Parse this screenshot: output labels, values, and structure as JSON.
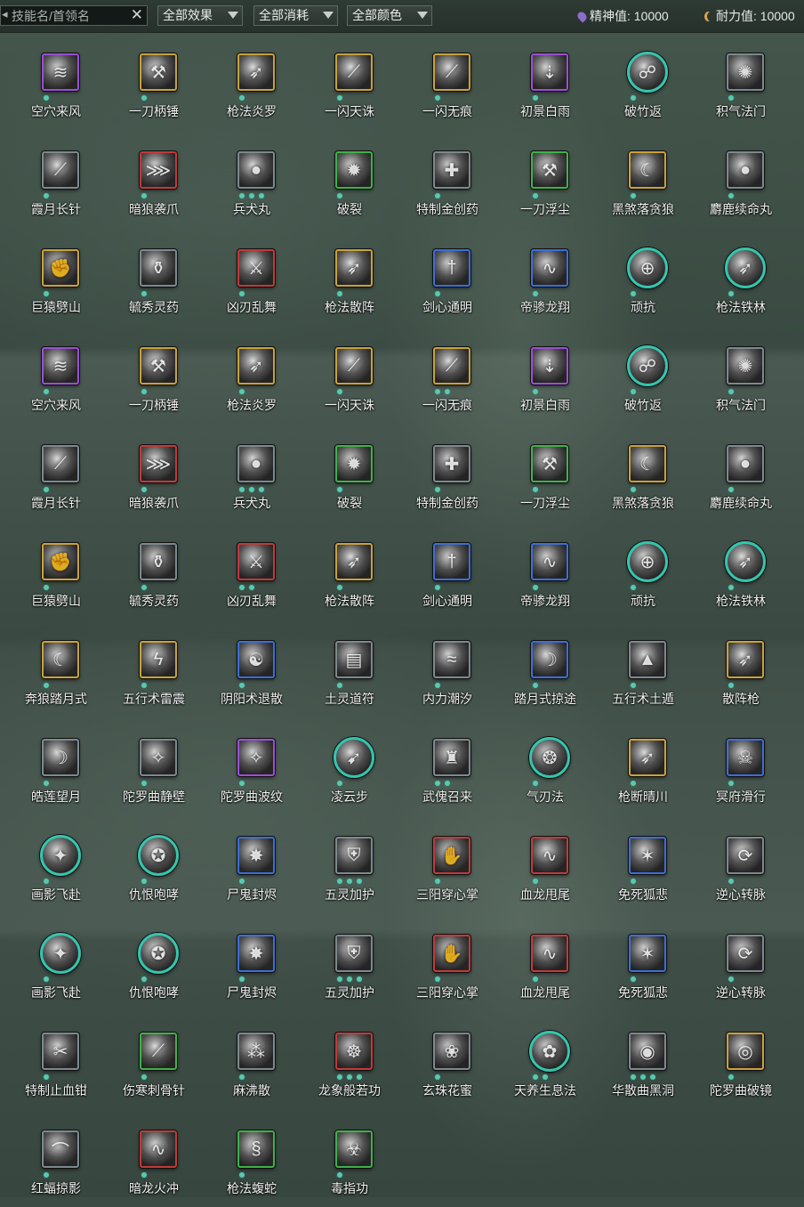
{
  "filters": {
    "search_placeholder": "技能名/首领名",
    "clear_symbol": "✕",
    "effect_label": "全部效果",
    "cost_label": "全部消耗",
    "color_label": "全部颜色"
  },
  "resources": {
    "spirit": "精神值: 10000",
    "stamina": "耐力值: 10000"
  },
  "colors": {
    "purple": "#9b4fd6",
    "gold": "#c9a23c",
    "red": "#c23a3a",
    "green": "#3fb24a",
    "blue": "#3b6fd6",
    "teal": "#34c6ad",
    "gray": "#7c8a8f",
    "dot": "#58c9b0"
  },
  "rows": [
    [
      {
        "name": "空穴来风",
        "frame": "purple",
        "dots": 1,
        "icon": "wind-icon"
      },
      {
        "name": "一刀柄锤",
        "frame": "gold",
        "dots": 1,
        "icon": "strike-icon"
      },
      {
        "name": "枪法炎罗",
        "frame": "gold",
        "dots": 1,
        "icon": "spear-icon"
      },
      {
        "name": "一闪天诛",
        "frame": "gold",
        "dots": 1,
        "icon": "slash-icon"
      },
      {
        "name": "一闪无痕",
        "frame": "gold",
        "dots": 1,
        "icon": "slash-icon"
      },
      {
        "name": "初景白雨",
        "frame": "purple",
        "dots": 1,
        "icon": "rain-icon"
      },
      {
        "name": "破竹返",
        "frame": "teal",
        "round": true,
        "dots": 1,
        "icon": "bamboo-icon"
      },
      {
        "name": "积气法门",
        "frame": "gray",
        "dots": 1,
        "icon": "qi-icon"
      }
    ],
    [
      {
        "name": "霞月长针",
        "frame": "gray",
        "dots": 1,
        "icon": "needle-icon"
      },
      {
        "name": "暗狼袭爪",
        "frame": "red",
        "dots": 1,
        "icon": "claw-icon"
      },
      {
        "name": "兵犬丸",
        "frame": "gray",
        "dots": 3,
        "icon": "pill-icon"
      },
      {
        "name": "破裂",
        "frame": "green",
        "dots": 1,
        "icon": "burst-icon"
      },
      {
        "name": "特制金创药",
        "frame": "gray",
        "dots": 1,
        "icon": "medicine-icon"
      },
      {
        "name": "一刀浮尘",
        "frame": "green",
        "dots": 1,
        "icon": "strike-icon"
      },
      {
        "name": "黑煞落贪狼",
        "frame": "gold",
        "dots": 1,
        "icon": "wolf-icon"
      },
      {
        "name": "麝鹿续命丸",
        "frame": "gray",
        "dots": 1,
        "icon": "pill-icon"
      }
    ],
    [
      {
        "name": "巨猿劈山",
        "frame": "gold",
        "dots": 1,
        "icon": "ape-icon"
      },
      {
        "name": "毓秀灵药",
        "frame": "gray",
        "dots": 1,
        "icon": "gourd-icon"
      },
      {
        "name": "凶刃乱舞",
        "frame": "red",
        "dots": 1,
        "icon": "blade-icon"
      },
      {
        "name": "枪法散阵",
        "frame": "gold",
        "dots": 1,
        "icon": "spear-icon"
      },
      {
        "name": "剑心通明",
        "frame": "blue",
        "dots": 1,
        "icon": "sword-icon"
      },
      {
        "name": "帝骖龙翔",
        "frame": "blue",
        "dots": 1,
        "icon": "dragon-icon"
      },
      {
        "name": "顽抗",
        "frame": "teal",
        "round": true,
        "dots": 1,
        "icon": "resist-icon"
      },
      {
        "name": "枪法铁林",
        "frame": "teal",
        "round": true,
        "dots": 1,
        "icon": "spear-icon"
      }
    ],
    [
      {
        "name": "空穴来风",
        "frame": "purple",
        "dots": 1,
        "icon": "wind-icon"
      },
      {
        "name": "一刀柄锤",
        "frame": "gold",
        "dots": 1,
        "icon": "strike-icon"
      },
      {
        "name": "枪法炎罗",
        "frame": "gold",
        "dots": 1,
        "icon": "spear-icon"
      },
      {
        "name": "一闪天诛",
        "frame": "gold",
        "dots": 1,
        "icon": "slash-icon"
      },
      {
        "name": "一闪无痕",
        "frame": "gold",
        "dots": 2,
        "icon": "slash-icon"
      },
      {
        "name": "初景白雨",
        "frame": "purple",
        "dots": 1,
        "icon": "rain-icon"
      },
      {
        "name": "破竹返",
        "frame": "teal",
        "round": true,
        "dots": 1,
        "icon": "bamboo-icon"
      },
      {
        "name": "积气法门",
        "frame": "gray",
        "dots": 1,
        "icon": "qi-icon"
      }
    ],
    [
      {
        "name": "霞月长针",
        "frame": "gray",
        "dots": 1,
        "icon": "needle-icon"
      },
      {
        "name": "暗狼袭爪",
        "frame": "red",
        "dots": 1,
        "icon": "claw-icon"
      },
      {
        "name": "兵犬丸",
        "frame": "gray",
        "dots": 3,
        "icon": "pill-icon"
      },
      {
        "name": "破裂",
        "frame": "green",
        "dots": 1,
        "icon": "burst-icon"
      },
      {
        "name": "特制金创药",
        "frame": "gray",
        "dots": 1,
        "icon": "medicine-icon"
      },
      {
        "name": "一刀浮尘",
        "frame": "green",
        "dots": 1,
        "icon": "strike-icon"
      },
      {
        "name": "黑煞落贪狼",
        "frame": "gold",
        "dots": 1,
        "icon": "wolf-icon"
      },
      {
        "name": "麝鹿续命丸",
        "frame": "gray",
        "dots": 1,
        "icon": "pill-icon"
      }
    ],
    [
      {
        "name": "巨猿劈山",
        "frame": "gold",
        "dots": 1,
        "icon": "ape-icon"
      },
      {
        "name": "毓秀灵药",
        "frame": "gray",
        "dots": 1,
        "icon": "gourd-icon"
      },
      {
        "name": "凶刃乱舞",
        "frame": "red",
        "dots": 2,
        "icon": "blade-icon"
      },
      {
        "name": "枪法散阵",
        "frame": "gold",
        "dots": 1,
        "icon": "spear-icon"
      },
      {
        "name": "剑心通明",
        "frame": "blue",
        "dots": 1,
        "icon": "sword-icon"
      },
      {
        "name": "帝骖龙翔",
        "frame": "blue",
        "dots": 1,
        "icon": "dragon-icon"
      },
      {
        "name": "顽抗",
        "frame": "teal",
        "round": true,
        "dots": 1,
        "icon": "resist-icon"
      },
      {
        "name": "枪法铁林",
        "frame": "teal",
        "round": true,
        "dots": 1,
        "icon": "spear-icon"
      }
    ],
    [
      {
        "name": "奔狼踏月式",
        "frame": "gold",
        "dots": 1,
        "icon": "wolf-icon"
      },
      {
        "name": "五行术雷震",
        "frame": "gold",
        "dots": 1,
        "icon": "thunder-icon"
      },
      {
        "name": "阴阳术退散",
        "frame": "blue",
        "dots": 1,
        "icon": "yinyang-icon"
      },
      {
        "name": "土灵道符",
        "frame": "gray",
        "dots": 1,
        "icon": "talisman-icon"
      },
      {
        "name": "内力潮汐",
        "frame": "gray",
        "dots": 1,
        "icon": "tide-icon"
      },
      {
        "name": "踏月式掠途",
        "frame": "blue",
        "dots": 1,
        "icon": "moon-icon"
      },
      {
        "name": "五行术土遁",
        "frame": "gray",
        "dots": 1,
        "icon": "earth-icon"
      },
      {
        "name": "散阵枪",
        "frame": "gold",
        "dots": 1,
        "icon": "spear-icon"
      }
    ],
    [
      {
        "name": "皓莲望月",
        "frame": "gray",
        "dots": 1,
        "icon": "moon-icon"
      },
      {
        "name": "陀罗曲静壁",
        "frame": "gray",
        "dots": 1,
        "icon": "dance-icon"
      },
      {
        "name": "陀罗曲波纹",
        "frame": "purple",
        "dots": 1,
        "icon": "dance-icon"
      },
      {
        "name": "凌云步",
        "frame": "teal",
        "round": true,
        "dots": 1,
        "icon": "step-icon"
      },
      {
        "name": "武傀召来",
        "frame": "gray",
        "dots": 2,
        "icon": "puppet-icon"
      },
      {
        "name": "气刃法",
        "frame": "teal",
        "round": true,
        "dots": 1,
        "icon": "qi-blade-icon"
      },
      {
        "name": "枪断晴川",
        "frame": "gold",
        "dots": 1,
        "icon": "spear-icon"
      },
      {
        "name": "冥府滑行",
        "frame": "blue",
        "dots": 1,
        "icon": "ghost-icon"
      }
    ],
    [
      {
        "name": "画影飞赴",
        "frame": "teal",
        "round": true,
        "dots": 1,
        "icon": "shadow-icon"
      },
      {
        "name": "仇恨咆哮",
        "frame": "teal",
        "round": true,
        "dots": 1,
        "icon": "roar-icon"
      },
      {
        "name": "尸鬼封烬",
        "frame": "blue",
        "dots": 1,
        "icon": "fire-icon"
      },
      {
        "name": "五灵加护",
        "frame": "gray",
        "dots": 3,
        "icon": "guard-icon"
      },
      {
        "name": "三阳穿心掌",
        "frame": "red",
        "dots": 1,
        "icon": "palm-icon"
      },
      {
        "name": "血龙甩尾",
        "frame": "red",
        "dots": 1,
        "icon": "dragon-icon"
      },
      {
        "name": "免死狐悲",
        "frame": "blue",
        "dots": 1,
        "icon": "fox-icon"
      },
      {
        "name": "逆心转脉",
        "frame": "gray",
        "dots": 1,
        "icon": "vein-icon"
      }
    ],
    [
      {
        "name": "画影飞赴",
        "frame": "teal",
        "round": true,
        "dots": 1,
        "icon": "shadow-icon"
      },
      {
        "name": "仇恨咆哮",
        "frame": "teal",
        "round": true,
        "dots": 1,
        "icon": "roar-icon"
      },
      {
        "name": "尸鬼封烬",
        "frame": "blue",
        "dots": 1,
        "icon": "fire-icon"
      },
      {
        "name": "五灵加护",
        "frame": "gray",
        "dots": 3,
        "icon": "guard-icon"
      },
      {
        "name": "三阳穿心掌",
        "frame": "red",
        "dots": 1,
        "icon": "palm-icon"
      },
      {
        "name": "血龙甩尾",
        "frame": "red",
        "dots": 1,
        "icon": "dragon-icon"
      },
      {
        "name": "免死狐悲",
        "frame": "blue",
        "dots": 1,
        "icon": "fox-icon"
      },
      {
        "name": "逆心转脉",
        "frame": "gray",
        "dots": 1,
        "icon": "vein-icon"
      }
    ],
    [
      {
        "name": "特制止血钳",
        "frame": "gray",
        "dots": 1,
        "icon": "clamp-icon"
      },
      {
        "name": "伤寒刺骨针",
        "frame": "green",
        "dots": 1,
        "icon": "needle-icon"
      },
      {
        "name": "麻沸散",
        "frame": "gray",
        "dots": 1,
        "icon": "powder-icon"
      },
      {
        "name": "龙象般若功",
        "frame": "red",
        "dots": 3,
        "icon": "prajna-icon"
      },
      {
        "name": "玄珠花蜜",
        "frame": "gray",
        "dots": 1,
        "icon": "nectar-icon"
      },
      {
        "name": "天养生息法",
        "frame": "teal",
        "round": true,
        "dots": 2,
        "icon": "breath-icon"
      },
      {
        "name": "华散曲黑洞",
        "frame": "gray",
        "dots": 3,
        "icon": "blackhole-icon"
      },
      {
        "name": "陀罗曲破镜",
        "frame": "gold",
        "dots": 1,
        "icon": "mirror-icon"
      }
    ],
    [
      {
        "name": "红蝠掠影",
        "frame": "gray",
        "dots": 1,
        "icon": "bat-icon"
      },
      {
        "name": "暗龙火冲",
        "frame": "red",
        "dots": 1,
        "icon": "dragon-icon"
      },
      {
        "name": "枪法蝮蛇",
        "frame": "green",
        "dots": 1,
        "icon": "snake-icon"
      },
      {
        "name": "毒指功",
        "frame": "green",
        "dots": 1,
        "icon": "poison-icon"
      }
    ]
  ]
}
